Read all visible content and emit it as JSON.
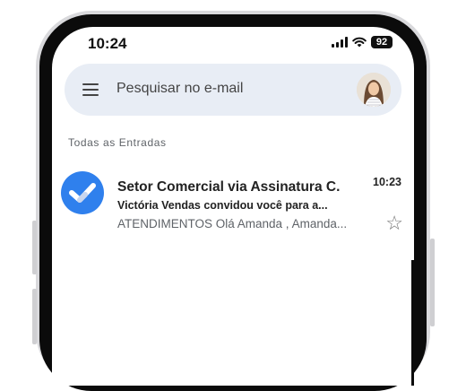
{
  "status_bar": {
    "time": "10:24",
    "battery": "92"
  },
  "search": {
    "placeholder": "Pesquisar no e-mail"
  },
  "section": {
    "label": "Todas as Entradas"
  },
  "emails": [
    {
      "sender": "Setor Comercial via Assinatura C.",
      "subject": "Victória Vendas convidou você para a...",
      "snippet": "ATENDIMENTOS Olá Amanda , Amanda...",
      "time": "10:23",
      "avatar_color": "#2f80ed"
    }
  ],
  "icons": [
    "menu-icon",
    "signal-icon",
    "wifi-icon",
    "battery-icon",
    "profile-avatar",
    "checkmark-icon",
    "star-icon"
  ]
}
